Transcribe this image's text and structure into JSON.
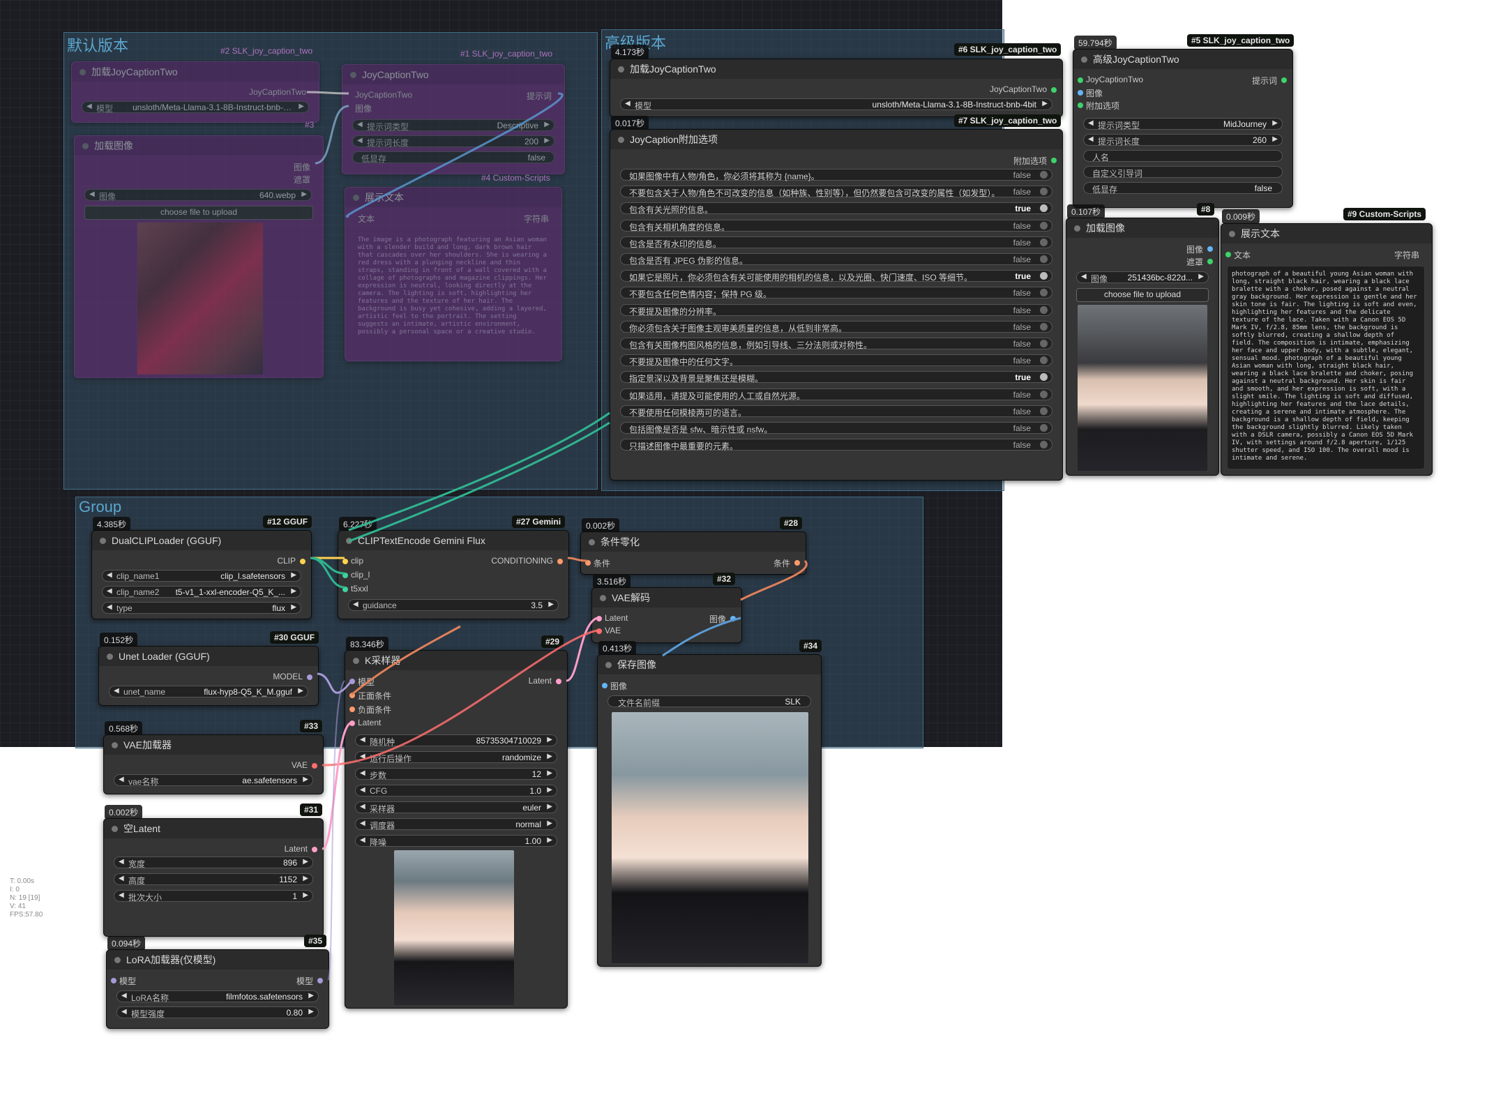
{
  "groups": {
    "default": "默认版本",
    "advanced": "高级版本",
    "group": "Group"
  },
  "ghost": {
    "node2": {
      "badge": "#2 SLK_joy_caption_two",
      "title": "加载JoyCaptionTwo",
      "out": "JoyCaptionTwo",
      "model_label": "模型",
      "model_value": "unsloth/Meta-Llama-3.1-8B-Instruct-bnb-4bit"
    },
    "node1": {
      "badge": "#1 SLK_joy_caption_two",
      "title": "JoyCaptionTwo",
      "in1": "JoyCaptionTwo",
      "in2": "图像",
      "out": "提示词",
      "w1_label": "提示词类型",
      "w1_value": "Descriptive",
      "w2_label": "提示词长度",
      "w2_value": "200",
      "w3_label": "低显存",
      "w3_value": "false"
    },
    "node3": {
      "badge": "#3",
      "title": "加载图像",
      "out1": "图像",
      "out2": "遮罩",
      "w_label": "图像",
      "w_value": "640.webp",
      "btn": "choose file to upload"
    },
    "node4": {
      "badge": "#4 Custom-Scripts",
      "title": "展示文本",
      "in": "文本",
      "out": "字符串",
      "text": "The image is a photograph featuring an Asian woman with a slender build and long, dark brown hair that cascades over her shoulders. She is wearing a red dress with a plunging neckline and thin straps, standing in front of a wall covered with a collage of photographs and magazine clippings. Her expression is neutral, looking directly at the camera. The lighting is soft, highlighting her features and the texture of her hair. The background is busy yet cohesive, adding a layered, artistic feel to the portrait. The setting suggests an intimate, artistic environment, possibly a personal space or a creative studio."
    }
  },
  "n6": {
    "badge": "#6 SLK_joy_caption_two",
    "timer": "4.173秒",
    "title": "加载JoyCaptionTwo",
    "out": "JoyCaptionTwo",
    "w_label": "模型",
    "w_value": "unsloth/Meta-Llama-3.1-8B-Instruct-bnb-4bit"
  },
  "n7": {
    "badge": "#7 SLK_joy_caption_two",
    "timer": "0.017秒",
    "title": "JoyCaption附加选项",
    "out": "附加选项",
    "options": [
      {
        "label": "如果图像中有人物/角色，你必须将其称为 {name}。",
        "value": "false",
        "on": false
      },
      {
        "label": "不要包含关于人物/角色不可改变的信息（如种族、性别等），但仍然要包含可改变的属性（如发型）。",
        "value": "false",
        "on": false
      },
      {
        "label": "包含有关光照的信息。",
        "value": "true",
        "on": true
      },
      {
        "label": "包含有关相机角度的信息。",
        "value": "false",
        "on": false
      },
      {
        "label": "包含是否有水印的信息。",
        "value": "false",
        "on": false
      },
      {
        "label": "包含是否有 JPEG 伪影的信息。",
        "value": "false",
        "on": false
      },
      {
        "label": "如果它是照片，你必须包含有关可能使用的相机的信息，以及光圈、快门速度、ISO 等细节。",
        "value": "true",
        "on": true
      },
      {
        "label": "不要包含任何色情内容；保持 PG 级。",
        "value": "false",
        "on": false
      },
      {
        "label": "不要提及图像的分辨率。",
        "value": "false",
        "on": false
      },
      {
        "label": "你必须包含关于图像主观审美质量的信息，从低到非常高。",
        "value": "false",
        "on": false
      },
      {
        "label": "包含有关图像构图风格的信息，例如引导线、三分法则或对称性。",
        "value": "false",
        "on": false
      },
      {
        "label": "不要提及图像中的任何文字。",
        "value": "false",
        "on": false
      },
      {
        "label": "指定景深以及背景是聚焦还是模糊。",
        "value": "true",
        "on": true
      },
      {
        "label": "如果适用，请提及可能使用的人工或自然光源。",
        "value": "false",
        "on": false
      },
      {
        "label": "不要使用任何模棱两可的语言。",
        "value": "false",
        "on": false
      },
      {
        "label": "包括图像是否是 sfw、暗示性或 nsfw。",
        "value": "false",
        "on": false
      },
      {
        "label": "只描述图像中最重要的元素。",
        "value": "false",
        "on": false
      }
    ]
  },
  "n5": {
    "badge": "#5 SLK_joy_caption_two",
    "timer": "59.794秒",
    "title": "高级JoyCaptionTwo",
    "in1": "JoyCaptionTwo",
    "in2": "图像",
    "in3": "附加选项",
    "out": "提示词",
    "w1_label": "提示词类型",
    "w1_value": "MidJourney",
    "w2_label": "提示词长度",
    "w2_value": "260",
    "f1": "人名",
    "f2": "自定义引导词",
    "w3_label": "低显存",
    "w3_value": "false"
  },
  "n8": {
    "badge": "#8",
    "timer": "0.107秒",
    "title": "加载图像",
    "out1": "图像",
    "out2": "遮罩",
    "w_label": "图像",
    "w_value": "251436bc-822d...",
    "btn": "choose file to upload"
  },
  "n9": {
    "badge": "#9 Custom-Scripts",
    "timer": "0.009秒",
    "title": "展示文本",
    "in": "文本",
    "out": "字符串",
    "text": "photograph of a beautiful young Asian woman with long, straight black hair, wearing a black lace bralette with a choker, posed against a neutral gray background. Her expression is gentle and her skin tone is fair. The lighting is soft and even, highlighting her features and the delicate texture of the lace. Taken with a Canon EOS 5D Mark IV, f/2.8, 85mm lens, the background is softly blurred, creating a shallow depth of field. The composition is intimate, emphasizing her face and upper body, with a subtle, elegant, sensual mood. photograph of a beautiful young Asian woman with long, straight black hair, wearing a black lace bralette and choker, posing against a neutral background. Her skin is fair and smooth, and her expression is soft, with a slight smile. The lighting is soft and diffused, highlighting her features and the lace details, creating a serene and intimate atmosphere. The background is a shallow depth of field, keeping the background slightly blurred. Likely taken with a DSLR camera, possibly a Canon EOS 5D Mark IV, with settings around f/2.8 aperture, 1/125 shutter speed, and ISO 100. The overall mood is intimate and serene."
  },
  "n12": {
    "badge": "#12 GGUF",
    "timer": "4.385秒",
    "title": "DualCLIPLoader (GGUF)",
    "out": "CLIP",
    "w1_label": "clip_name1",
    "w1_value": "clip_l.safetensors",
    "w2_label": "clip_name2",
    "w2_value": "t5-v1_1-xxl-encoder-Q5_K_...",
    "w3_label": "type",
    "w3_value": "flux"
  },
  "n27": {
    "badge": "#27 Gemini",
    "timer": "6.227秒",
    "title": "CLIPTextEncode Gemini Flux",
    "in1": "clip",
    "in2": "clip_l",
    "in3": "t5xxl",
    "out": "CONDITIONING",
    "w_label": "guidance",
    "w_value": "3.5"
  },
  "n28": {
    "badge": "#28",
    "timer": "0.002秒",
    "title": "条件零化",
    "in": "条件",
    "out": "条件"
  },
  "n32": {
    "badge": "#32",
    "timer": "3.516秒",
    "title": "VAE解码",
    "in1": "Latent",
    "in2": "VAE",
    "out": "图像"
  },
  "n30": {
    "badge": "#30 GGUF",
    "timer": "0.152秒",
    "title": "Unet Loader (GGUF)",
    "out": "MODEL",
    "w_label": "unet_name",
    "w_value": "flux-hyp8-Q5_K_M.gguf"
  },
  "n29": {
    "badge": "#29",
    "timer": "83.346秒",
    "title": "K采样器",
    "in1": "模型",
    "in2": "正面条件",
    "in3": "负面条件",
    "in4": "Latent",
    "out": "Latent",
    "widgets": [
      {
        "label": "随机种",
        "value": "857353047100​29"
      },
      {
        "label": "运行后操作",
        "value": "randomize"
      },
      {
        "label": "步数",
        "value": "12"
      },
      {
        "label": "CFG",
        "value": "1.0"
      },
      {
        "label": "采样器",
        "value": "euler"
      },
      {
        "label": "调度器",
        "value": "normal"
      },
      {
        "label": "降噪",
        "value": "1.00"
      }
    ]
  },
  "n34": {
    "badge": "#34",
    "timer": "0.413秒",
    "title": "保存图像",
    "in": "图像",
    "w_label": "文件名前缀",
    "w_value": "SLK"
  },
  "n33": {
    "badge": "#33",
    "timer": "0.568秒",
    "title": "VAE加载器",
    "out": "VAE",
    "w_label": "vae名称",
    "w_value": "ae.safetensors"
  },
  "n31": {
    "badge": "#31",
    "timer": "0.002秒",
    "title": "空Latent",
    "out": "Latent",
    "widgets": [
      {
        "label": "宽度",
        "value": "896"
      },
      {
        "label": "高度",
        "value": "1152"
      },
      {
        "label": "批次大小",
        "value": "1"
      }
    ]
  },
  "n35": {
    "badge": "#35",
    "timer": "0.094秒",
    "title": "LoRA加载器(仅模型)",
    "in": "模型",
    "out": "模型",
    "w1_label": "LoRA名称",
    "w1_value": "filmfotos.safetensors",
    "w2_label": "模型强度",
    "w2_value": "0.80"
  },
  "stats": [
    "T: 0.00s",
    "I: 0",
    "N: 19 [19]",
    "V: 41",
    "FPS:57.80"
  ],
  "colors": {
    "purple_node": "#672a74",
    "group_fill": "#3e607a",
    "wire_green": "#2fb48f",
    "wire_orange": "#e0805a",
    "wire_blue": "#5b9bd5",
    "wire_lavender": "#a79ad6"
  },
  "icons": {
    "arrow_left": "◀",
    "arrow_right": "▶"
  }
}
